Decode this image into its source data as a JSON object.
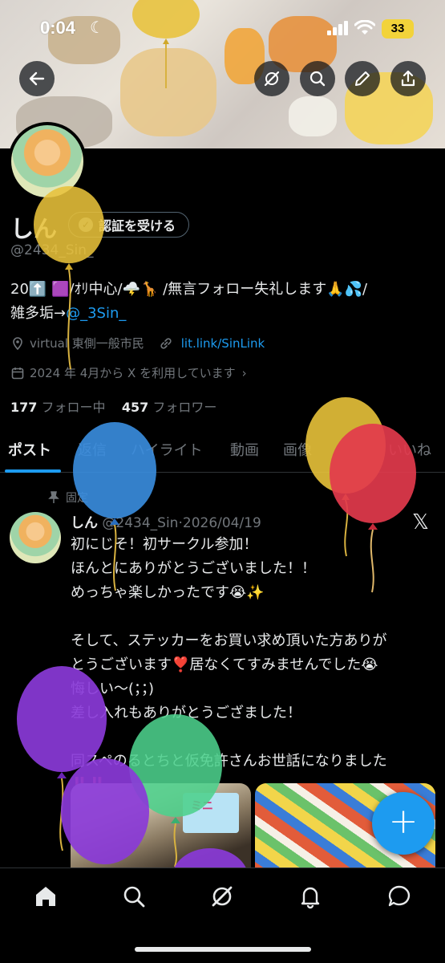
{
  "status_bar": {
    "time": "0:04",
    "battery": "33"
  },
  "profile": {
    "name": "しん",
    "verify_label": "認証を受ける",
    "handle": "@2434_Sin_",
    "bio_line1": "20⬆️ 🟪/ｵﾘ中心/🌩️🦒 /無言フォロー失礼します🙏💦/",
    "bio_line2_prefix": "雑多垢→",
    "bio_link": "@_3Sin_",
    "location": "virtual 東側一般市民",
    "website": "lit.link/SinLink",
    "joined": "2024 年 4月から X を利用しています",
    "following_count": "177",
    "following_label": "フォロー中",
    "followers_count": "457",
    "followers_label": "フォロワー"
  },
  "tabs": [
    "ポスト",
    "返信",
    "ハイライト",
    "動画",
    "画像",
    "いいね"
  ],
  "post": {
    "pinned_label": "固定",
    "author": "しん",
    "handle": "@2434_Sin",
    "dot": "·",
    "date": "2026/04/19",
    "lines": [
      "初にじそ！初サークル参加！",
      "ほんとにありがとうございました！！",
      "めっちゃ楽しかったです😭✨",
      "",
      "そして、ステッカーをお買い求め頂いた方ありが",
      "とうございます❣️居なくてすみませんでした😭",
      "悔しい〜(；；)",
      "差し入れもありがとうござました！",
      "",
      "同スペのるとちと仮免許さんお世話になりました",
      "‼️‼️"
    ],
    "media_overlay_text": "ミニ"
  },
  "fab_label": "+",
  "icons": {
    "back": "back-arrow-icon",
    "grok": "grok-icon",
    "search": "search-icon",
    "edit": "pencil-icon",
    "share": "share-icon",
    "location": "location-pin-icon",
    "link": "link-icon",
    "calendar": "calendar-icon",
    "pin": "pin-icon",
    "x": "x-logo-icon"
  },
  "colors": {
    "accent": "#1d9bf0",
    "background": "#000000",
    "text": "#e7e9ea",
    "muted": "#71767b"
  }
}
